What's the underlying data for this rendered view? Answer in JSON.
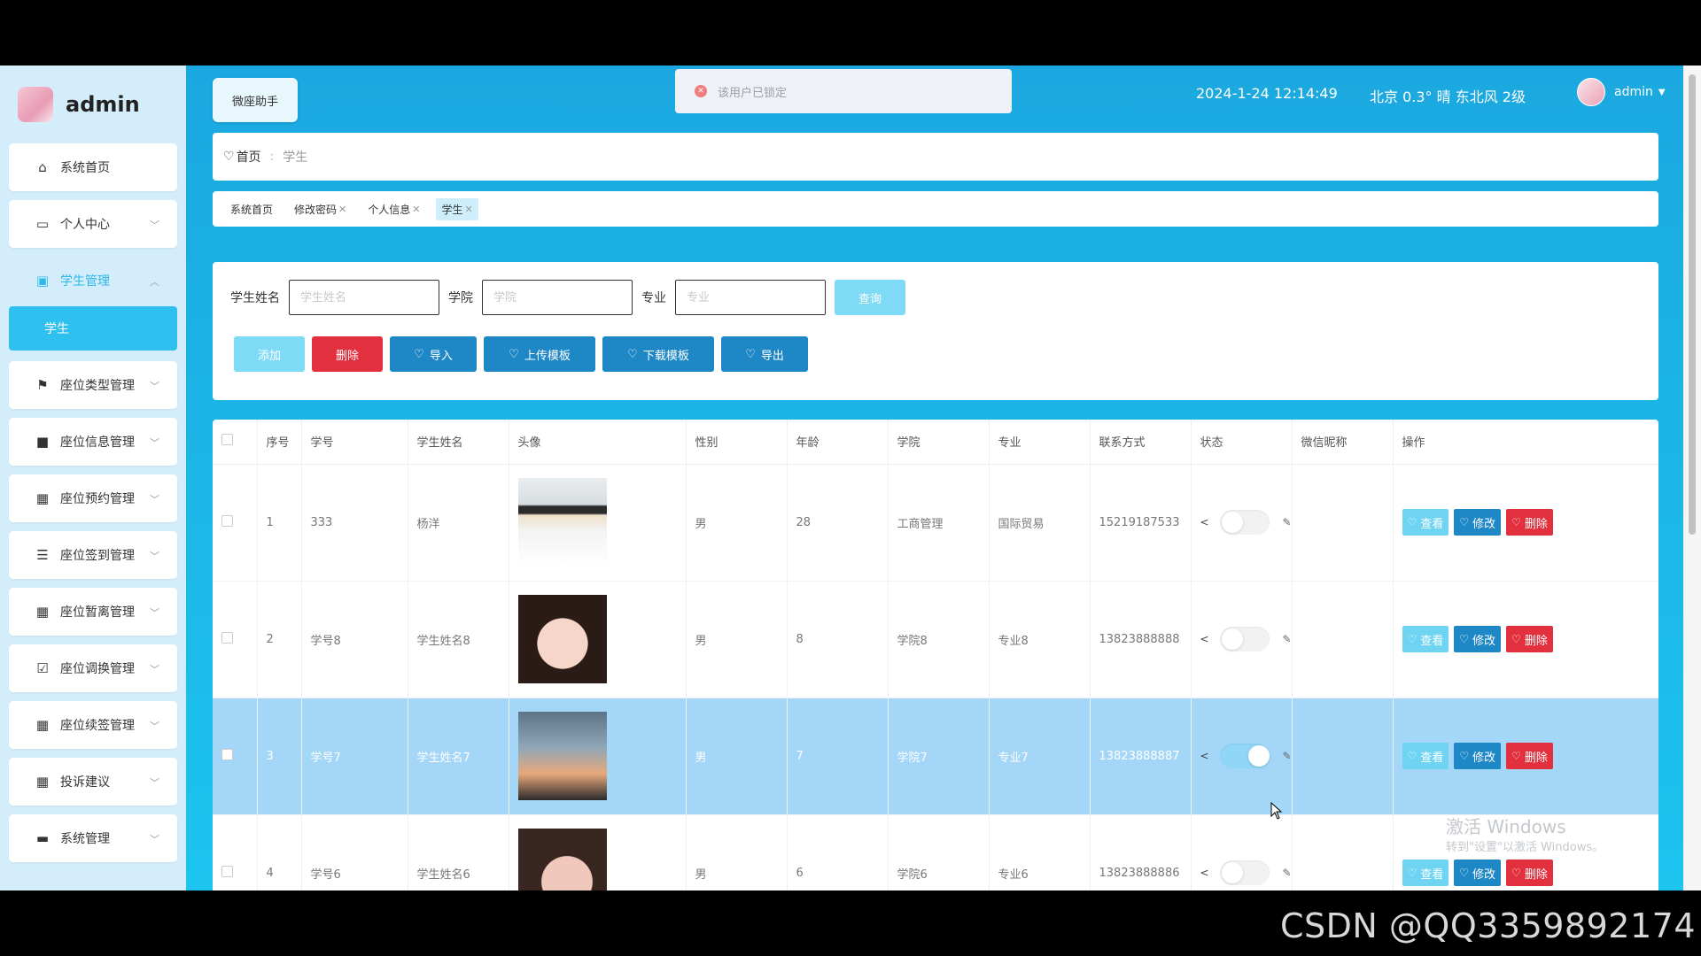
{
  "sidebar": {
    "username": "admin",
    "items": [
      {
        "label": "系统首页",
        "icon": "home-icon"
      },
      {
        "label": "个人中心",
        "icon": "card-icon"
      },
      {
        "label": "学生管理",
        "icon": "id-card-icon"
      },
      {
        "label": "座位类型管理",
        "icon": "flag-icon"
      },
      {
        "label": "座位信息管理",
        "icon": "camera-icon"
      },
      {
        "label": "座位预约管理",
        "icon": "grid-icon"
      },
      {
        "label": "座位签到管理",
        "icon": "sliders-icon"
      },
      {
        "label": "座位暂离管理",
        "icon": "apps-icon"
      },
      {
        "label": "座位调换管理",
        "icon": "checklist-icon"
      },
      {
        "label": "座位续签管理",
        "icon": "grid-icon"
      },
      {
        "label": "投诉建议",
        "icon": "grid-icon"
      },
      {
        "label": "系统管理",
        "icon": "monitor-icon"
      }
    ],
    "submenu": "学生"
  },
  "header": {
    "assistant_button": "微座助手",
    "toast": "该用户已锁定",
    "datetime": "2024-1-24 12:14:49",
    "weather": "北京  0.3°  晴  东北风  2级",
    "user": "admin"
  },
  "breadcrumb": {
    "home": "首页",
    "current": "学生"
  },
  "tabs": [
    {
      "label": "系统首页",
      "closable": false,
      "active": false
    },
    {
      "label": "修改密码",
      "closable": true,
      "active": false
    },
    {
      "label": "个人信息",
      "closable": true,
      "active": false
    },
    {
      "label": "学生",
      "closable": true,
      "active": true
    }
  ],
  "search": {
    "name_label": "学生姓名",
    "name_placeholder": "学生姓名",
    "college_label": "学院",
    "college_placeholder": "学院",
    "major_label": "专业",
    "major_placeholder": "专业",
    "query_button": "查询"
  },
  "actions": {
    "add": "添加",
    "delete": "删除",
    "import": "导入",
    "upload_template": "上传模板",
    "download_template": "下载模板",
    "export": "导出"
  },
  "table": {
    "columns": [
      "序号",
      "学号",
      "学生姓名",
      "头像",
      "性别",
      "年龄",
      "学院",
      "专业",
      "联系方式",
      "状态",
      "微信昵称",
      "操作"
    ],
    "rows": [
      {
        "no": "1",
        "sid": "333",
        "name": "杨洋",
        "gender": "男",
        "age": "28",
        "college": "工商管理",
        "major": "国际贸易",
        "phone": "15219187533",
        "status_on": false,
        "wechat": ""
      },
      {
        "no": "2",
        "sid": "学号8",
        "name": "学生姓名8",
        "gender": "男",
        "age": "8",
        "college": "学院8",
        "major": "专业8",
        "phone": "13823888888",
        "status_on": false,
        "wechat": ""
      },
      {
        "no": "3",
        "sid": "学号7",
        "name": "学生姓名7",
        "gender": "男",
        "age": "7",
        "college": "学院7",
        "major": "专业7",
        "phone": "13823888887",
        "status_on": true,
        "wechat": ""
      },
      {
        "no": "4",
        "sid": "学号6",
        "name": "学生姓名6",
        "gender": "男",
        "age": "6",
        "college": "学院6",
        "major": "专业6",
        "phone": "13823888886",
        "status_on": false,
        "wechat": ""
      }
    ],
    "op_view": "查看",
    "op_edit": "修改",
    "op_delete": "删除"
  },
  "os_watermark": {
    "line1": "激活 Windows",
    "line2": "转到\"设置\"以激活 Windows。"
  },
  "footer_watermark": "CSDN @QQ3359892174",
  "colors": {
    "accent": "#30c0f0",
    "danger": "#e3303e",
    "primary_dark": "#1e87c6",
    "light_btn": "#6fd3f2"
  }
}
